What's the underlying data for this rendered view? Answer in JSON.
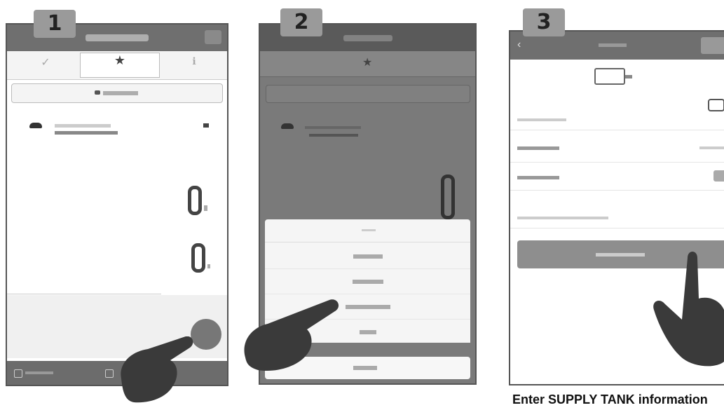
{
  "steps": {
    "one": {
      "badge": "1"
    },
    "two": {
      "badge": "2"
    },
    "three": {
      "badge": "3"
    }
  },
  "caption": "Enter SUPPLY TANK information"
}
